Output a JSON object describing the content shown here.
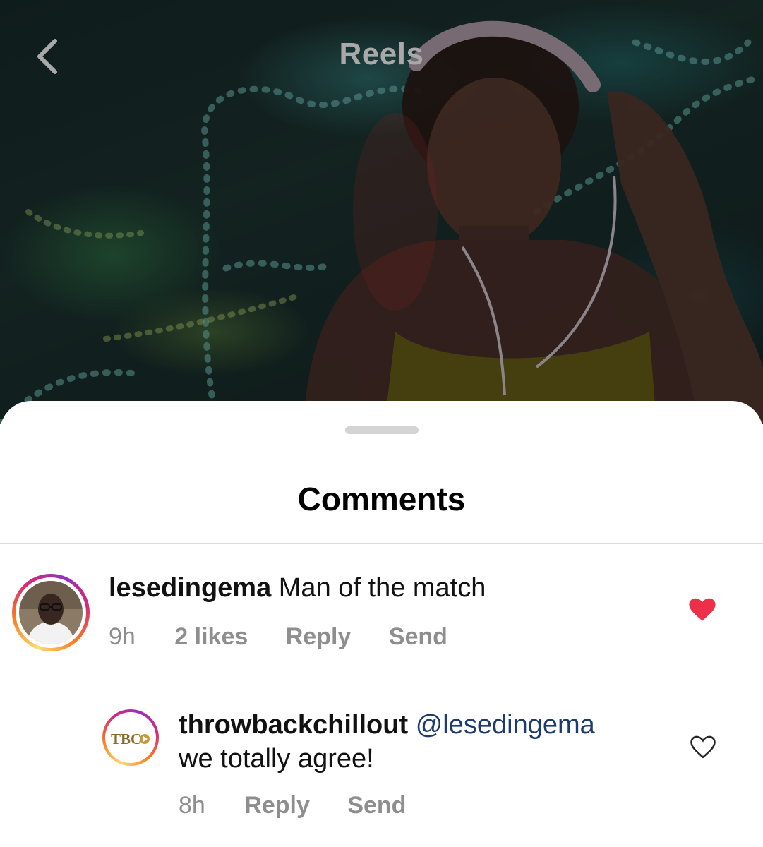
{
  "header": {
    "title": "Reels",
    "back_icon": "chevron-left-icon"
  },
  "sheet": {
    "title": "Comments"
  },
  "comments": [
    {
      "username": "lesedingema",
      "text": "Man of the match",
      "time": "9h",
      "likes": "2 likes",
      "reply_label": "Reply",
      "send_label": "Send",
      "liked": true,
      "heart_color": "#ed2f4a"
    },
    {
      "username": "throwbackchillout",
      "mention": "@lesedingema",
      "text": "we totally agree!",
      "time": "8h",
      "reply_label": "Reply",
      "send_label": "Send",
      "liked": false,
      "avatar_logo": "TBC"
    }
  ],
  "colors": {
    "username": "#111111",
    "mention": "#1d3b6e",
    "meta": "#8e8e8e",
    "title_overlay": "#a9a9a9"
  }
}
